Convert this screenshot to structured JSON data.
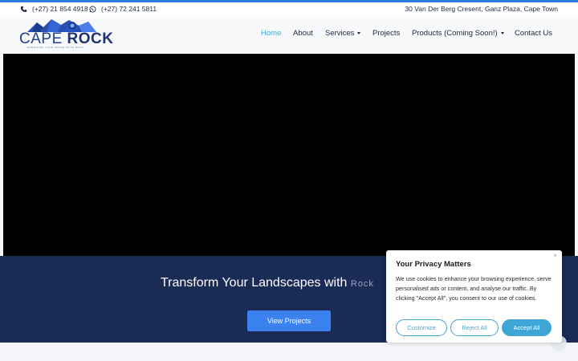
{
  "topbar": {
    "phone": "(+27) 21 854 4918",
    "whatsapp": "(+27) 72 241 5811",
    "address": "30 Van Der Berg Cresent, Ganz Plaza, Cape Town"
  },
  "logo": {
    "text_a": "CAPE ",
    "text_b": "ROCK",
    "tagline": "ENERGIZE YOUR SPACE WITH ROCK"
  },
  "nav": {
    "items": [
      {
        "label": "Home",
        "active": true
      },
      {
        "label": "About"
      },
      {
        "label": "Services",
        "dropdown": true
      },
      {
        "label": "Projects"
      },
      {
        "label": "Products (Coming Soon!)",
        "dropdown": true
      },
      {
        "label": "Contact Us"
      }
    ]
  },
  "banner": {
    "title": "Transform Your Landscapes with ",
    "title_fade": "Rock",
    "button": "View Projects"
  },
  "cookie": {
    "title": "Your Privacy Matters",
    "body": "We use cookies to enhance your browsing experience, serve personalised ads or content, and analyse our traffic. By clicking \"Accept All\", you consent to our use of cookies.",
    "close": "×",
    "customize": "Customize",
    "reject": "Reject All",
    "accept": "Accept All"
  },
  "colors": {
    "accent": "#2d7be0",
    "nav_active": "#3fa6d6",
    "banner_bg": "#1a2b55",
    "button_bg": "#3b82f0"
  }
}
